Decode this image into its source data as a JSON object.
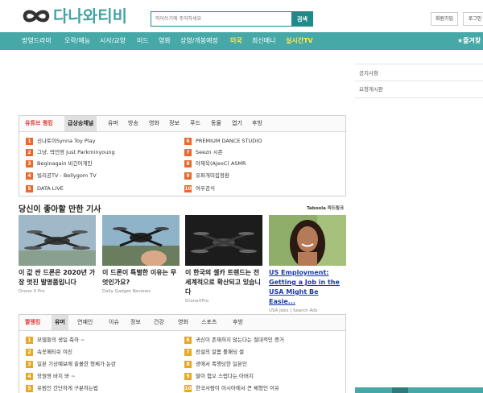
{
  "header": {
    "logo_text": "다나와티비",
    "search_placeholder": "띄어쓰기에 주의하세요",
    "search_button": "검색",
    "join_button": "회원가입",
    "login_button": "로그인"
  },
  "nav": {
    "items": [
      "방영드라마",
      "오락/예능",
      "시사/교양",
      "미드",
      "영화",
      "상영/개봉예정",
      "미국",
      "최신매니",
      "실시간TV",
      "★즐겨찾"
    ]
  },
  "sidebar": {
    "links": [
      "공지사항",
      "요청게시판"
    ]
  },
  "youtube_ranking": {
    "tabs": [
      "유튜브 랭킹",
      "급상승채널",
      "유머",
      "방송",
      "영화",
      "정보",
      "푸드",
      "동물",
      "엽기",
      "후방"
    ],
    "left": [
      {
        "num": "1",
        "text": "신나토이Synna Toy Play"
      },
      {
        "num": "2",
        "text": "그냥, 박민영 Just Parkminyoung"
      },
      {
        "num": "3",
        "text": "Beginagain 비긴어게인"
      },
      {
        "num": "4",
        "text": "빌리공TV - Bellygom TV"
      },
      {
        "num": "5",
        "text": "DATA LIVE"
      }
    ],
    "right": [
      {
        "num": "6",
        "text": "PREMIUM DANCE STUDIO"
      },
      {
        "num": "7",
        "text": "Seezn 시즌"
      },
      {
        "num": "8",
        "text": "아재욱(AjeoC) ASMR"
      },
      {
        "num": "9",
        "text": "유퍼개미집정환"
      },
      {
        "num": "10",
        "text": "여우공식"
      }
    ]
  },
  "recommend": {
    "title": "당신이 좋아할 만한 기사",
    "taboola": "Taboola 피드링크",
    "cards": [
      {
        "title": "이 값 싼 드론은 2020년 가장 멋진 발명품입니다",
        "source": "Drone X Pro"
      },
      {
        "title": "이 드론이 특별한 이유는 무엇인가요?",
        "source": "Daily Gadget Reviews"
      },
      {
        "title": "이 한국의 셀카 트렌드는 전 세계적으로 확산되고 있습니다",
        "source": "DroneXPro"
      },
      {
        "title": "US Employment: Getting a Job in the USA Might Be Easie...",
        "source": "USA Jobs | Search Ads"
      }
    ]
  },
  "humor_ranking": {
    "tabs": [
      "짤랭킹",
      "유머",
      "연예인",
      "이슈",
      "정보",
      "건강",
      "영화",
      "스포츠",
      "후방"
    ],
    "left": [
      {
        "num": "1",
        "text": "모델들의 생일 축하 ~"
      },
      {
        "num": "2",
        "text": "속옷페티쉬 여진"
      },
      {
        "num": "3",
        "text": "일본 기상예보에 출몰한 형체가 논란"
      },
      {
        "num": "4",
        "text": "장원영 바지 봐 ~"
      },
      {
        "num": "5",
        "text": "유림인 간단하게 구분하는법"
      }
    ],
    "right": [
      {
        "num": "6",
        "text": "귀신이 존재하지 않는다는 절대적인 증거"
      },
      {
        "num": "7",
        "text": "전설의 알몸 롤패딩 썰"
      },
      {
        "num": "8",
        "text": "광에서 폭행당한 일본인"
      },
      {
        "num": "9",
        "text": "딸이 험오 스럽다는 아버지"
      },
      {
        "num": "10",
        "text": "한국사람이 아시아에서 큰 체형인 이유"
      }
    ]
  },
  "colors": {
    "teal": "#47a8a8",
    "dark_teal": "#1f8a8a",
    "rank_red": "#e8692a",
    "rank_gold": "#e8a72a",
    "nav_highlight": "#ffe94d"
  }
}
